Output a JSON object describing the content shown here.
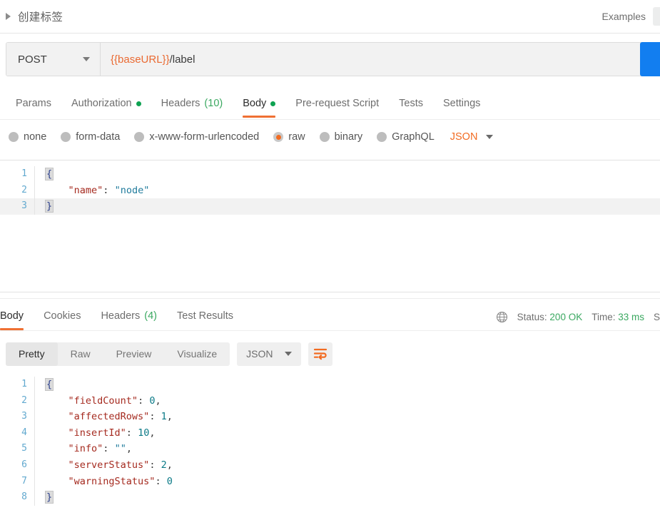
{
  "header": {
    "title": "创建标签",
    "expand_icon": "triangle-right-icon",
    "examples_label": "Examples"
  },
  "url_bar": {
    "method": "POST",
    "method_caret": "chevron-down-icon",
    "url_variable": "{{baseURL}}",
    "url_path": "/label",
    "send_label": ""
  },
  "request_tabs": [
    {
      "label": "Params",
      "badge": "",
      "dot": false,
      "active": false
    },
    {
      "label": "Authorization",
      "badge": "",
      "dot": true,
      "active": false
    },
    {
      "label": "Headers",
      "badge": "(10)",
      "dot": false,
      "active": false
    },
    {
      "label": "Body",
      "badge": "",
      "dot": true,
      "active": true
    },
    {
      "label": "Pre-request Script",
      "badge": "",
      "dot": false,
      "active": false
    },
    {
      "label": "Tests",
      "badge": "",
      "dot": false,
      "active": false
    },
    {
      "label": "Settings",
      "badge": "",
      "dot": false,
      "active": false
    }
  ],
  "body_types": {
    "options": [
      {
        "label": "none",
        "selected": false
      },
      {
        "label": "form-data",
        "selected": false
      },
      {
        "label": "x-www-form-urlencoded",
        "selected": false
      },
      {
        "label": "raw",
        "selected": true
      },
      {
        "label": "binary",
        "selected": false
      },
      {
        "label": "GraphQL",
        "selected": false
      }
    ],
    "format": "JSON"
  },
  "request_body": {
    "lines": [
      {
        "n": "1",
        "indent": 0,
        "tokens": [
          {
            "t": "brace",
            "v": "{"
          }
        ]
      },
      {
        "n": "2",
        "indent": 4,
        "tokens": [
          {
            "t": "key",
            "v": "\"name\""
          },
          {
            "t": "pun",
            "v": ": "
          },
          {
            "t": "str",
            "v": "\"node\""
          }
        ]
      },
      {
        "n": "3",
        "indent": 0,
        "active": true,
        "tokens": [
          {
            "t": "brace",
            "v": "}"
          }
        ]
      }
    ]
  },
  "response_tabs": [
    {
      "label": "Body",
      "badge": "",
      "active": true
    },
    {
      "label": "Cookies",
      "badge": "",
      "active": false
    },
    {
      "label": "Headers",
      "badge": "(4)",
      "active": false
    },
    {
      "label": "Test Results",
      "badge": "",
      "active": false
    }
  ],
  "response_status": {
    "globe_icon": "globe-icon",
    "status_label": "Status:",
    "status_value": "200 OK",
    "time_label": "Time:",
    "time_value": "33 ms",
    "size_label": "S"
  },
  "response_controls": {
    "views": [
      {
        "label": "Pretty",
        "active": true
      },
      {
        "label": "Raw",
        "active": false
      },
      {
        "label": "Preview",
        "active": false
      },
      {
        "label": "Visualize",
        "active": false
      }
    ],
    "format": "JSON",
    "wrap_icon": "word-wrap-icon"
  },
  "response_body": {
    "lines": [
      {
        "n": "1",
        "indent": 0,
        "tokens": [
          {
            "t": "brace",
            "v": "{"
          }
        ]
      },
      {
        "n": "2",
        "indent": 4,
        "tokens": [
          {
            "t": "key",
            "v": "\"fieldCount\""
          },
          {
            "t": "pun",
            "v": ": "
          },
          {
            "t": "num",
            "v": "0"
          },
          {
            "t": "pun",
            "v": ","
          }
        ]
      },
      {
        "n": "3",
        "indent": 4,
        "tokens": [
          {
            "t": "key",
            "v": "\"affectedRows\""
          },
          {
            "t": "pun",
            "v": ": "
          },
          {
            "t": "num",
            "v": "1"
          },
          {
            "t": "pun",
            "v": ","
          }
        ]
      },
      {
        "n": "4",
        "indent": 4,
        "tokens": [
          {
            "t": "key",
            "v": "\"insertId\""
          },
          {
            "t": "pun",
            "v": ": "
          },
          {
            "t": "num",
            "v": "10"
          },
          {
            "t": "pun",
            "v": ","
          }
        ]
      },
      {
        "n": "5",
        "indent": 4,
        "tokens": [
          {
            "t": "key",
            "v": "\"info\""
          },
          {
            "t": "pun",
            "v": ": "
          },
          {
            "t": "str",
            "v": "\"\""
          },
          {
            "t": "pun",
            "v": ","
          }
        ]
      },
      {
        "n": "6",
        "indent": 4,
        "tokens": [
          {
            "t": "key",
            "v": "\"serverStatus\""
          },
          {
            "t": "pun",
            "v": ": "
          },
          {
            "t": "num",
            "v": "2"
          },
          {
            "t": "pun",
            "v": ","
          }
        ]
      },
      {
        "n": "7",
        "indent": 4,
        "tokens": [
          {
            "t": "key",
            "v": "\"warningStatus\""
          },
          {
            "t": "pun",
            "v": ": "
          },
          {
            "t": "num",
            "v": "0"
          }
        ]
      },
      {
        "n": "8",
        "indent": 0,
        "tokens": [
          {
            "t": "brace",
            "v": "}"
          }
        ]
      }
    ]
  },
  "colors": {
    "accent_orange": "#ef7033",
    "send_blue": "#127ef0",
    "success_green": "#3aa860",
    "dot_green": "#0ea252"
  }
}
